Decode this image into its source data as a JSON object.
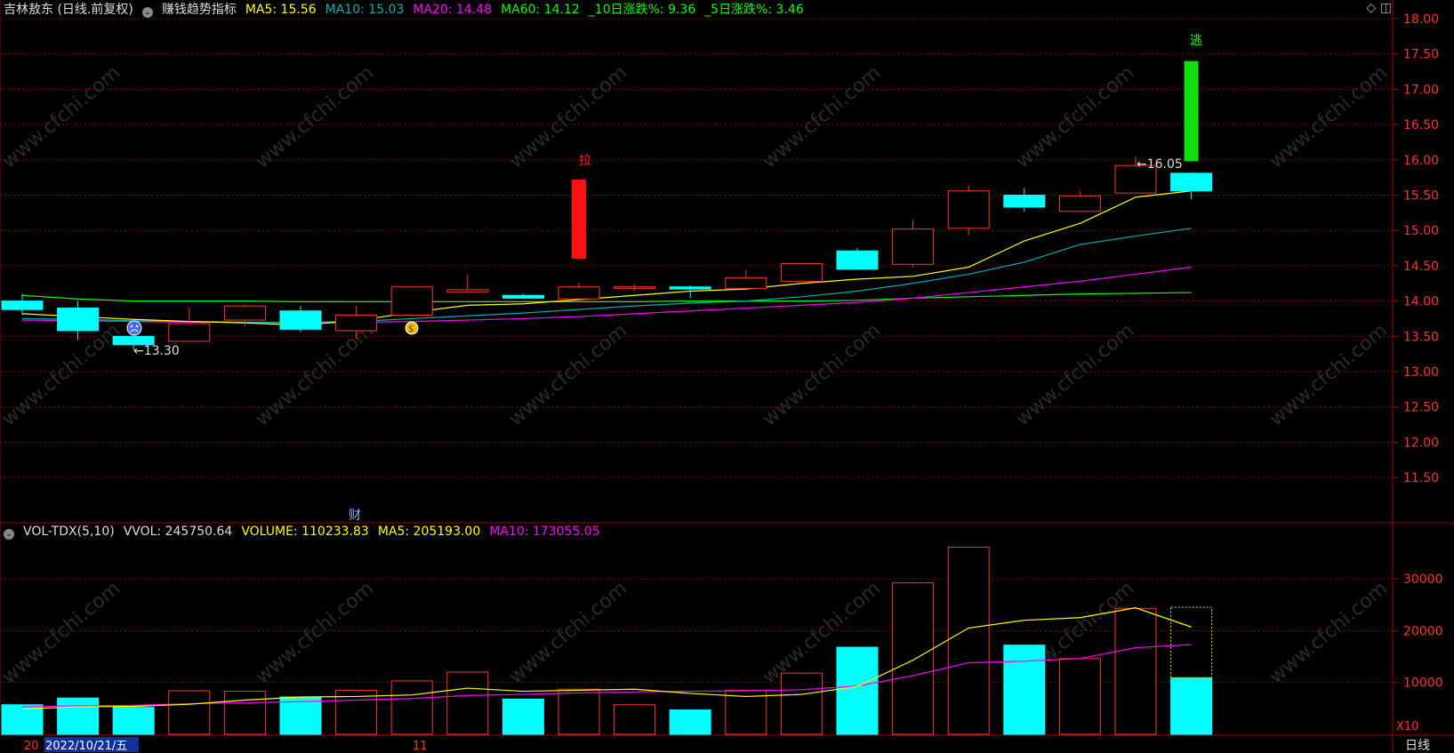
{
  "header": {
    "title": "吉林敖东 (日线.前复权)",
    "indicator": "赚钱趋势指标",
    "ma5": "MA5: 15.56",
    "ma10": "MA10: 15.03",
    "ma20": "MA20: 14.48",
    "ma60": "MA60: 14.12",
    "chg10": "_10日涨跌%: 9.36",
    "chg5": "_5日涨跌%: 3.46"
  },
  "volume_header": {
    "name": "VOL-TDX(5,10)",
    "vvol": "VVOL: 245750.64",
    "volume": "VOLUME: 110233.83",
    "ma5": "MA5: 205193.00",
    "ma10": "MA10: 173055.05"
  },
  "colors": {
    "up": "#ff3232",
    "down": "#00ffff",
    "ma5": "#ffff00",
    "ma10": "#00b0b0",
    "ma20": "#ff00ff",
    "ma60": "#00ff00",
    "grid": "#800000"
  },
  "annotations": {
    "low_label": "←13.30",
    "high_label": "←16.05",
    "pull_label": "拉",
    "escape_label": "逃",
    "finance_label": "财"
  },
  "footer": {
    "date_prefix": "20",
    "date": "2022/10/21/五",
    "month": "11",
    "period": "日线",
    "vol_unit": "X10"
  },
  "chart_data": [
    {
      "type": "candlestick",
      "price_ticks": [
        11.5,
        12.0,
        12.5,
        13.0,
        13.5,
        14.0,
        14.5,
        15.0,
        15.5,
        16.0,
        16.5,
        17.0,
        17.5,
        18.0
      ],
      "ylim": [
        11.0,
        18.15
      ],
      "candles": [
        {
          "open": 14.0,
          "high": 14.1,
          "low": 13.8,
          "close": 13.88
        },
        {
          "open": 13.9,
          "high": 14.0,
          "low": 13.45,
          "close": 13.58
        },
        {
          "open": 13.5,
          "high": 13.6,
          "low": 13.3,
          "close": 13.38
        },
        {
          "open": 13.43,
          "high": 13.9,
          "low": 13.43,
          "close": 13.68
        },
        {
          "open": 13.73,
          "high": 13.95,
          "low": 13.65,
          "close": 13.93
        },
        {
          "open": 13.86,
          "high": 13.93,
          "low": 13.56,
          "close": 13.6
        },
        {
          "open": 13.58,
          "high": 13.93,
          "low": 13.46,
          "close": 13.8
        },
        {
          "open": 13.8,
          "high": 14.2,
          "low": 13.78,
          "close": 14.2
        },
        {
          "open": 14.13,
          "high": 14.38,
          "low": 14.12,
          "close": 14.16
        },
        {
          "open": 14.08,
          "high": 14.1,
          "low": 14.04,
          "close": 14.04
        },
        {
          "open": 14.03,
          "high": 14.26,
          "low": 14.03,
          "close": 14.2
        },
        {
          "open": 14.18,
          "high": 14.24,
          "low": 14.15,
          "close": 14.2
        },
        {
          "open": 14.2,
          "high": 14.22,
          "low": 14.04,
          "close": 14.17
        },
        {
          "open": 14.18,
          "high": 14.44,
          "low": 14.17,
          "close": 14.33
        },
        {
          "open": 14.28,
          "high": 14.53,
          "low": 14.27,
          "close": 14.53
        },
        {
          "open": 14.71,
          "high": 14.75,
          "low": 14.45,
          "close": 14.45
        },
        {
          "open": 14.52,
          "high": 15.15,
          "low": 14.48,
          "close": 15.02
        },
        {
          "open": 15.03,
          "high": 15.64,
          "low": 14.93,
          "close": 15.56
        },
        {
          "open": 15.5,
          "high": 15.6,
          "low": 15.27,
          "close": 15.33
        },
        {
          "open": 15.27,
          "high": 15.56,
          "low": 15.27,
          "close": 15.49
        },
        {
          "open": 15.53,
          "high": 16.05,
          "low": 15.53,
          "close": 15.92
        },
        {
          "open": 15.81,
          "high": 15.82,
          "low": 15.44,
          "close": 15.56
        }
      ],
      "ma5": [
        13.82,
        13.78,
        13.74,
        13.71,
        13.69,
        13.66,
        13.72,
        13.84,
        13.94,
        13.96,
        14.02,
        14.08,
        14.14,
        14.17,
        14.25,
        14.31,
        14.35,
        14.48,
        14.85,
        15.1,
        15.47,
        15.56
      ],
      "ma10": [
        13.75,
        13.74,
        13.72,
        13.71,
        13.7,
        13.7,
        13.71,
        13.75,
        13.79,
        13.83,
        13.88,
        13.93,
        13.97,
        14.0,
        14.06,
        14.14,
        14.25,
        14.38,
        14.55,
        14.8,
        14.92,
        15.03
      ],
      "ma20": [
        13.73,
        13.72,
        13.71,
        13.7,
        13.7,
        13.69,
        13.7,
        13.71,
        13.73,
        13.75,
        13.78,
        13.82,
        13.86,
        13.9,
        13.94,
        13.98,
        14.04,
        14.12,
        14.2,
        14.28,
        14.38,
        14.48
      ],
      "ma60": [
        14.08,
        14.03,
        14.0,
        14.0,
        14.0,
        13.99,
        13.99,
        13.99,
        13.99,
        13.99,
        13.99,
        13.99,
        14.0,
        14.0,
        14.0,
        14.01,
        14.04,
        14.06,
        14.08,
        14.1,
        14.11,
        14.12
      ],
      "signals": [
        {
          "index": 10,
          "direction": "up",
          "from": 14.6,
          "to": 15.72
        },
        {
          "index": 21,
          "direction": "down",
          "from": 17.4,
          "to": 15.98
        }
      ]
    },
    {
      "type": "bar",
      "name": "VOLUME",
      "unit": "X10",
      "ticks": [
        10000,
        20000,
        30000
      ],
      "ylim": [
        0,
        40000
      ],
      "values": [
        5700,
        7000,
        5200,
        8400,
        8300,
        7200,
        8500,
        10300,
        12000,
        6800,
        8700,
        5700,
        4700,
        8500,
        11800,
        16800,
        29200,
        36100,
        17200,
        14600,
        24300,
        10900
      ],
      "directions": [
        "down",
        "down",
        "down",
        "up",
        "up",
        "down",
        "up",
        "up",
        "up",
        "down",
        "up",
        "up",
        "down",
        "up",
        "up",
        "down",
        "up",
        "up",
        "down",
        "up",
        "up",
        "down"
      ],
      "last_outline": 24500,
      "ma5": [
        4900,
        5300,
        5400,
        5800,
        6600,
        7200,
        7300,
        7600,
        8900,
        8300,
        8500,
        8700,
        7900,
        7300,
        7700,
        9200,
        14300,
        20500,
        22000,
        22500,
        24400,
        20700
      ],
      "ma10": [
        5300,
        5500,
        5600,
        5900,
        6100,
        6300,
        6600,
        6900,
        7500,
        7700,
        8000,
        8200,
        8300,
        8400,
        8600,
        9300,
        11300,
        13800,
        14100,
        14600,
        16700,
        17300
      ]
    }
  ]
}
